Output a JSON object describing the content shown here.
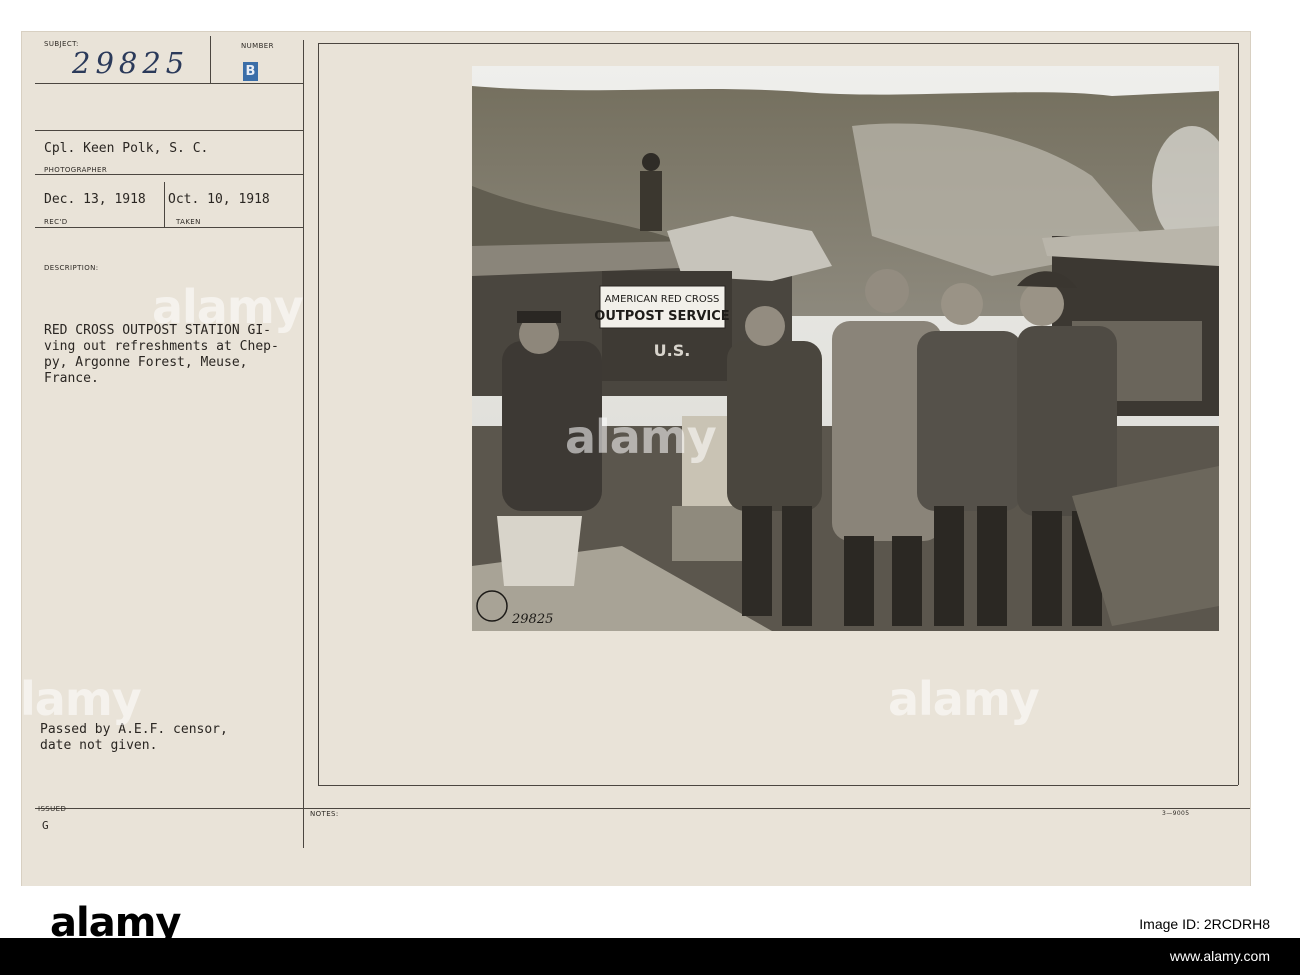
{
  "card": {
    "subject_label": "SUBJECT:",
    "number_label": "NUMBER",
    "subject_handwritten": "29825",
    "number_stamp": "B",
    "photographer_name": "Cpl. Keen Polk, S. C.",
    "photographer_label": "PHOTOGRAPHER",
    "received_date": "Dec. 13, 1918",
    "received_label": "REC'D",
    "taken_date": "Oct. 10, 1918",
    "taken_label": "TAKEN",
    "description_label": "DESCRIPTION:",
    "description_lines": [
      "RED CROSS OUTPOST STATION GI-",
      "ving out refreshments at Chep-",
      "py, Argonne Forest, Meuse,",
      "France."
    ],
    "censor_lines": [
      "Passed by A.E.F. censor,",
      "date not given."
    ],
    "issued_label": "ISSUED",
    "issued_value": "G",
    "notes_label": "NOTES:",
    "form_code": "3—9005"
  },
  "photo": {
    "sign_line1": "AMERICAN RED CROSS",
    "sign_line2": "OUTPOST SERVICE",
    "sign_line3": "U.S.",
    "stamp_number": "29825"
  },
  "watermark": {
    "text": "alamy"
  },
  "footer": {
    "logo": "alamy",
    "image_id_label": "Image ID: 2RCDRH8",
    "url": "www.alamy.com"
  },
  "colors": {
    "card": "#e9e3d8",
    "ink": "#2a2622",
    "rule": "#4b4640",
    "stamp_blue": "#3b6ea8",
    "handwriting": "#2b3a5a"
  }
}
